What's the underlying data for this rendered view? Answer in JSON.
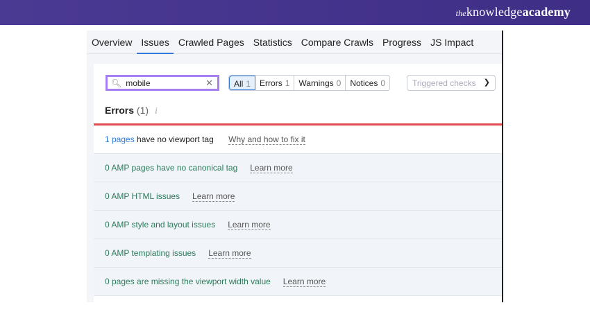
{
  "brand": {
    "logo_prefix": "the",
    "logo_main": "knowledge",
    "logo_suffix": "academy"
  },
  "tabs": [
    "Overview",
    "Issues",
    "Crawled Pages",
    "Statistics",
    "Compare Crawls",
    "Progress",
    "JS Impact"
  ],
  "active_tab": "Issues",
  "search": {
    "value": "mobile"
  },
  "filters": [
    {
      "label": "All",
      "count": "1"
    },
    {
      "label": "Errors",
      "count": "1"
    },
    {
      "label": "Warnings",
      "count": "0"
    },
    {
      "label": "Notices",
      "count": "0"
    }
  ],
  "triggered_placeholder": "Triggered checks",
  "errors_heading": {
    "title": "Errors",
    "count": "(1)",
    "info": "i"
  },
  "first_row": {
    "link": "1 pages",
    "text": " have no viewport tag",
    "help": "Why and how to fix it"
  },
  "rows": [
    {
      "text": "0 AMP pages have no canonical tag",
      "help": "Learn more"
    },
    {
      "text": "0 AMP HTML issues",
      "help": "Learn more"
    },
    {
      "text": "0 AMP style and layout issues",
      "help": "Learn more"
    },
    {
      "text": "0 AMP templating issues",
      "help": "Learn more"
    },
    {
      "text": "0 pages are missing the viewport width value",
      "help": "Learn more"
    }
  ],
  "colors": {
    "brand": "#4b3a93",
    "search_highlight": "#a87ff2",
    "error_line": "#e5484d",
    "link": "#2d78d8",
    "ok_text": "#2c7a5a"
  }
}
